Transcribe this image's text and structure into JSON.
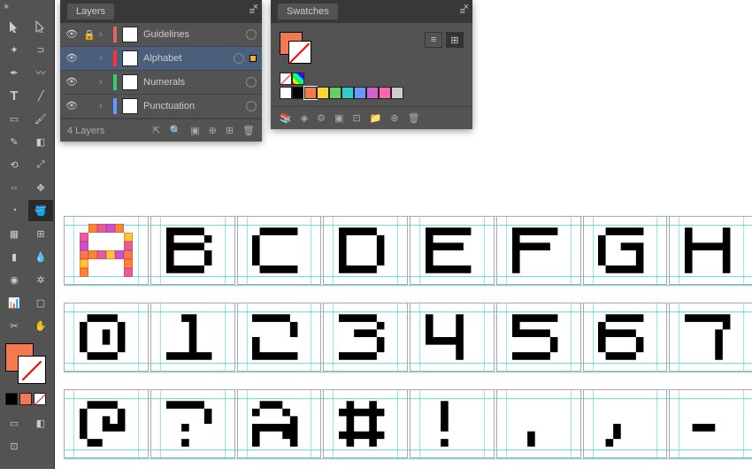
{
  "layers_panel": {
    "title": "Layers",
    "rows": [
      {
        "name": "Guidelines",
        "color": "#e06666",
        "locked": true
      },
      {
        "name": "Alphabet",
        "color": "#ff3333",
        "selected": true
      },
      {
        "name": "Numerals",
        "color": "#33cc66"
      },
      {
        "name": "Punctuation",
        "color": "#6699ff"
      }
    ],
    "count_label": "4 Layers"
  },
  "swatches_panel": {
    "title": "Swatches",
    "colors": [
      "#ffffff",
      "#fff-none",
      "#000000",
      "#f47950",
      "#ffd633",
      "#66cc66",
      "#33cccc",
      "#6699ff",
      "#cc66cc",
      "#ff66aa",
      "#cccccc"
    ]
  },
  "toolbar": {
    "fill": "#f47950",
    "mini": [
      "#000000",
      "#f47950",
      "#ffffff-none"
    ]
  },
  "canvas": {
    "row1": [
      "A",
      "B",
      "C",
      "D",
      "E",
      "F",
      "G",
      "H"
    ],
    "row2": [
      "0",
      "1",
      "2",
      "3",
      "4",
      "5",
      "6",
      "7"
    ],
    "row3": [
      "@",
      "?",
      "&",
      "#",
      "!",
      ".",
      ",",
      "-"
    ]
  }
}
